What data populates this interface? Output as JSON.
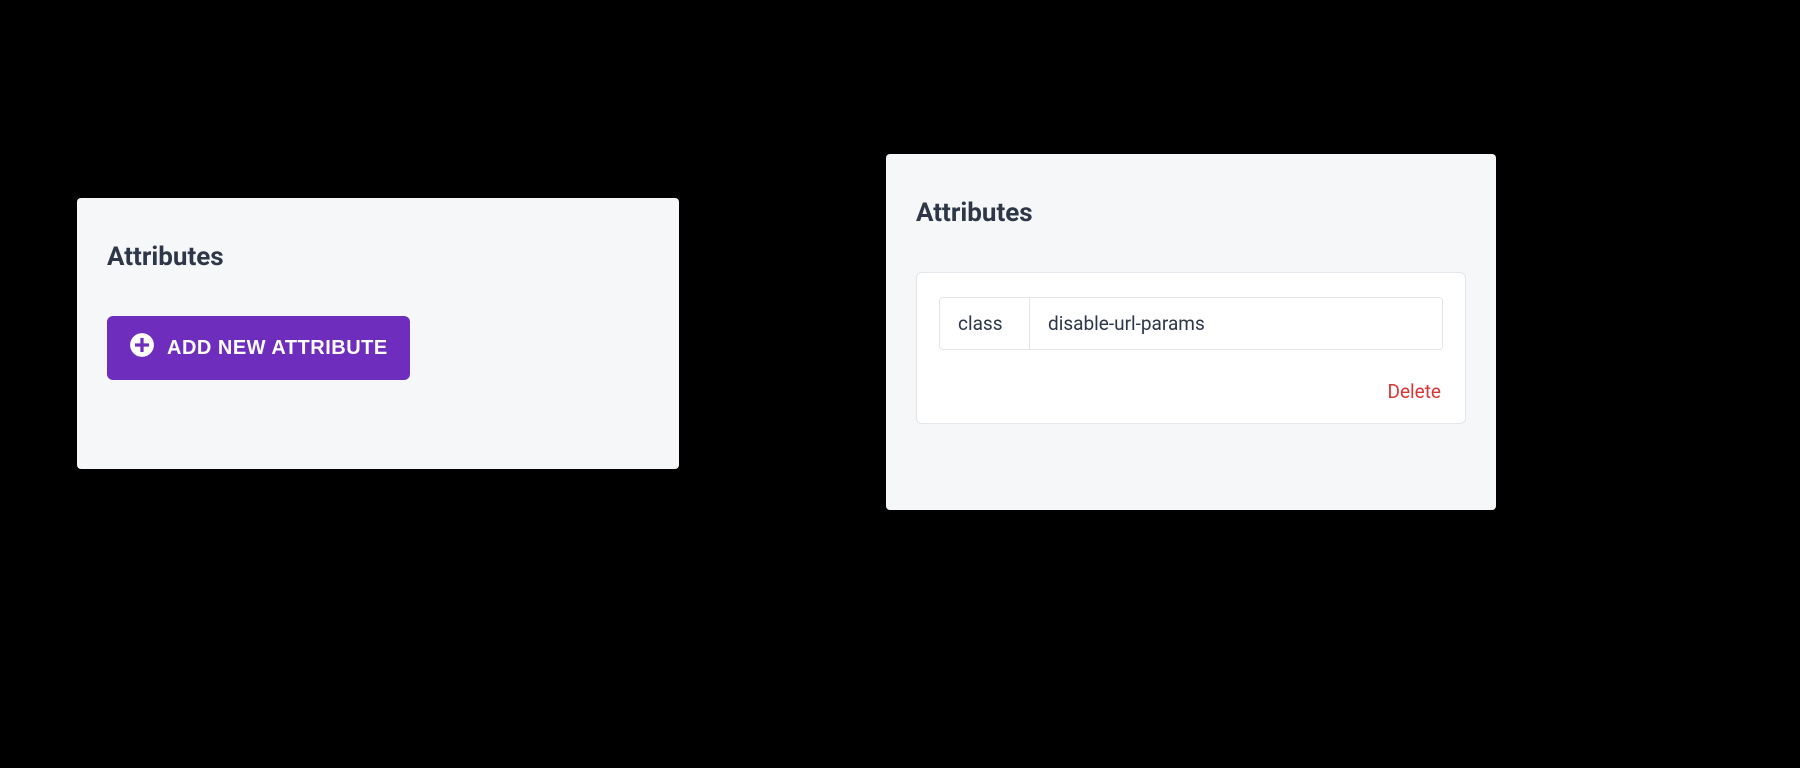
{
  "left_panel": {
    "title": "Attributes",
    "add_button_label": "ADD NEW ATTRIBUTE"
  },
  "right_panel": {
    "title": "Attributes",
    "attribute": {
      "key": "class",
      "value": "disable-url-params"
    },
    "delete_label": "Delete"
  },
  "colors": {
    "accent": "#6f2dbd",
    "danger": "#d93636",
    "panel_bg": "#f6f7f9",
    "text": "#2d3748"
  }
}
